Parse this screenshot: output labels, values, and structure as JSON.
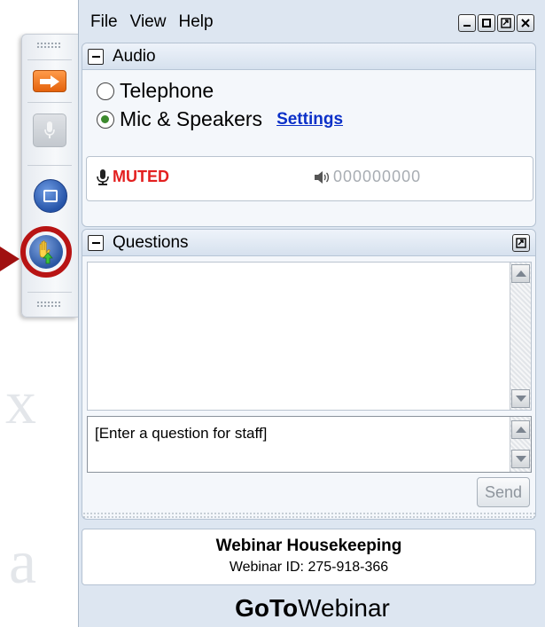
{
  "menu": {
    "file": "File",
    "view": "View",
    "help": "Help"
  },
  "window_controls": [
    {
      "icon": "minimize-icon"
    },
    {
      "icon": "maximize-icon"
    },
    {
      "icon": "restore-icon"
    },
    {
      "icon": "close-icon"
    }
  ],
  "sidebar": {
    "buttons": [
      {
        "icon": "arrow-right-icon"
      },
      {
        "icon": "microphone-icon"
      },
      {
        "icon": "screen-icon"
      },
      {
        "icon": "raise-hand-icon"
      }
    ]
  },
  "audio": {
    "title": "Audio",
    "options": [
      {
        "label": "Telephone",
        "selected": false
      },
      {
        "label": "Mic & Speakers",
        "selected": true
      }
    ],
    "settings_link": "Settings",
    "mic_status": "MUTED",
    "speaker_meter": "000000000"
  },
  "questions": {
    "title": "Questions",
    "input_placeholder": "[Enter a question for staff]",
    "send_label": "Send"
  },
  "info": {
    "title": "Webinar Housekeeping",
    "webinar_id": "Webinar ID: 275-918-366"
  },
  "brand": {
    "part1": "GoTo",
    "part2": "Webinar"
  },
  "colors": {
    "accent_orange": "#e4620c",
    "muted_red": "#e32020",
    "link_blue": "#0b30c8",
    "hand_ring_red": "#b81414"
  }
}
